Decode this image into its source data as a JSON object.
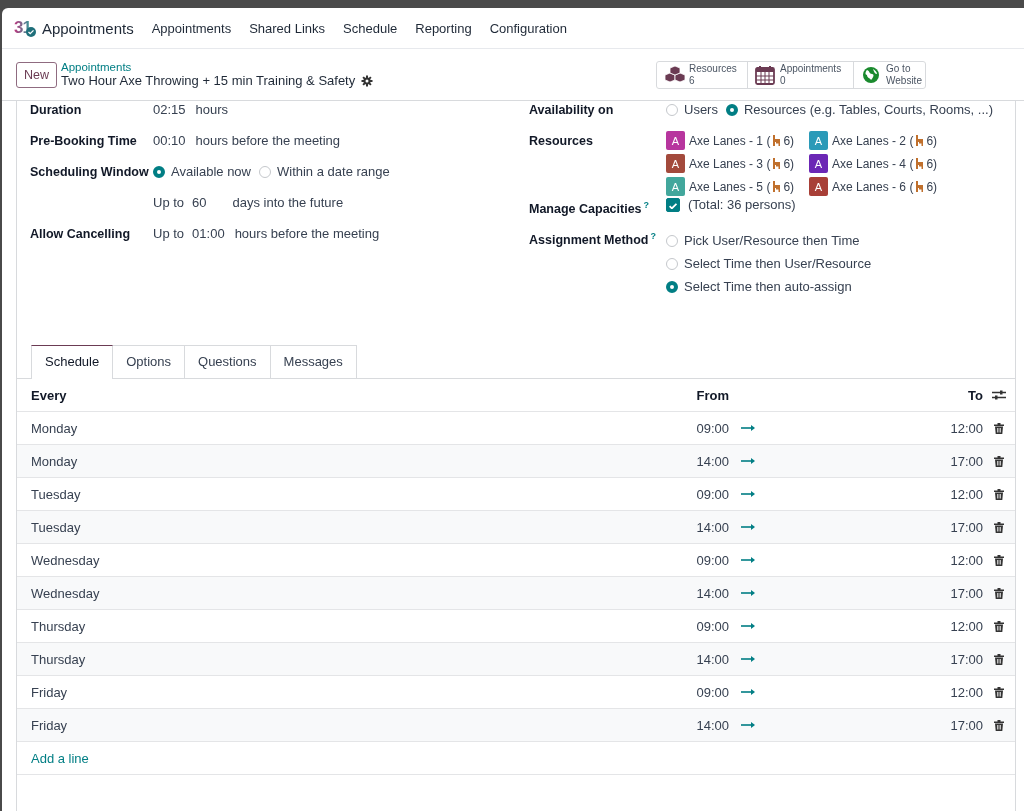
{
  "app": {
    "logo": "31",
    "name": "Appointments",
    "menu": [
      "Appointments",
      "Shared Links",
      "Schedule",
      "Reporting",
      "Configuration"
    ]
  },
  "control_panel": {
    "new_button": "New",
    "breadcrumb": "Appointments",
    "record_title": "Two Hour Axe Throwing + 15 min Training & Safety",
    "stat_buttons": [
      {
        "kind": "resources",
        "label": "Resources",
        "value": "6"
      },
      {
        "kind": "calendar",
        "label": "Appointments",
        "value": "0"
      },
      {
        "kind": "website",
        "label": "Go to",
        "value": "Website"
      }
    ]
  },
  "fields_left": [
    {
      "kind": "duration",
      "label": "Duration",
      "value": "02:15",
      "suffix": "hours"
    },
    {
      "kind": "duration",
      "label": "Pre-Booking Time",
      "value": "00:10",
      "suffix": "hours before the meeting"
    },
    {
      "kind": "radio",
      "label": "Scheduling Window",
      "options": [
        {
          "label": "Available now",
          "selected": true
        },
        {
          "label": "Within a date range",
          "selected": false
        }
      ]
    },
    {
      "kind": "limit",
      "prefix": "Up to",
      "value": "60",
      "suffix": "days into the future"
    },
    {
      "kind": "limit",
      "label": "Allow Cancelling",
      "prefix": "Up to",
      "value": "01:00",
      "suffix": "hours before the meeting"
    }
  ],
  "fields_right": [
    {
      "kind": "radio",
      "label": "Availability on",
      "options": [
        {
          "label": "Users",
          "selected": false
        },
        {
          "label": "Resources (e.g. Tables, Courts, Rooms, ...)",
          "selected": true
        }
      ]
    },
    {
      "kind": "tags",
      "label": "Resources",
      "tags": [
        {
          "initial": "A",
          "name": "Axe Lanes - 1 (",
          "capacity": "6)",
          "color": "#b7359e"
        },
        {
          "initial": "A",
          "name": "Axe Lanes - 2 (",
          "capacity": "6)",
          "color": "#2b9ab8"
        },
        {
          "initial": "A",
          "name": "Axe Lanes - 3 (",
          "capacity": "6)",
          "color": "#a34a3c"
        },
        {
          "initial": "A",
          "name": "Axe Lanes - 4 (",
          "capacity": "6)",
          "color": "#6b27b5"
        },
        {
          "initial": "A",
          "name": "Axe Lanes - 5 (",
          "capacity": "6)",
          "color": "#42a79c"
        },
        {
          "initial": "A",
          "name": "Axe Lanes - 6 (",
          "capacity": "6)",
          "color": "#a83f37"
        }
      ]
    },
    {
      "kind": "checkbox",
      "label": "Manage Capacities",
      "help": "?",
      "checked": true,
      "text": "(Total: 36 persons)"
    },
    {
      "kind": "radio_list",
      "label": "Assignment Method",
      "help": "?",
      "options": [
        {
          "label": "Pick User/Resource then Time",
          "selected": false
        },
        {
          "label": "Select Time then User/Resource",
          "selected": false
        },
        {
          "label": "Select Time then auto-assign",
          "selected": true
        }
      ]
    }
  ],
  "tabs": [
    {
      "label": "Schedule",
      "selected": true
    },
    {
      "label": "Options",
      "selected": false
    },
    {
      "label": "Questions",
      "selected": false
    },
    {
      "label": "Messages",
      "selected": false
    }
  ],
  "table": {
    "columns": [
      "Every",
      "From",
      "To"
    ],
    "rows": [
      {
        "every": "Monday",
        "from": "09:00",
        "to": "12:00"
      },
      {
        "every": "Monday",
        "from": "14:00",
        "to": "17:00"
      },
      {
        "every": "Tuesday",
        "from": "09:00",
        "to": "12:00"
      },
      {
        "every": "Tuesday",
        "from": "14:00",
        "to": "17:00"
      },
      {
        "every": "Wednesday",
        "from": "09:00",
        "to": "12:00"
      },
      {
        "every": "Wednesday",
        "from": "14:00",
        "to": "17:00"
      },
      {
        "every": "Thursday",
        "from": "09:00",
        "to": "12:00"
      },
      {
        "every": "Thursday",
        "from": "14:00",
        "to": "17:00"
      },
      {
        "every": "Friday",
        "from": "09:00",
        "to": "12:00"
      },
      {
        "every": "Friday",
        "from": "14:00",
        "to": "17:00"
      }
    ],
    "add_line": "Add a line"
  }
}
